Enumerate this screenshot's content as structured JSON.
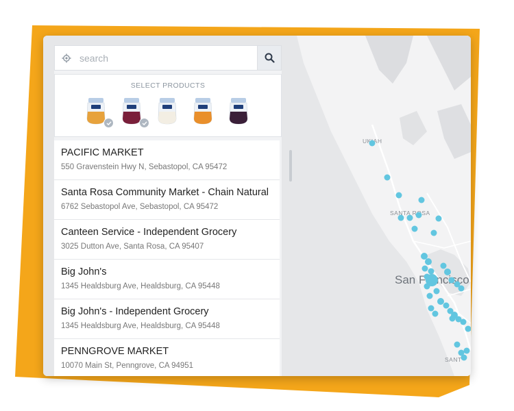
{
  "search": {
    "placeholder": "search"
  },
  "products": {
    "title": "SELECT PRODUCTS",
    "items": [
      {
        "name": "product-1",
        "lid": "#b8cde6",
        "fill": "#e7a23c",
        "checked": true
      },
      {
        "name": "product-2",
        "lid": "#b8cde6",
        "fill": "#7a1f3a",
        "checked": true
      },
      {
        "name": "product-3",
        "lid": "#b8cde6",
        "fill": "#f3eee3",
        "checked": false
      },
      {
        "name": "product-4",
        "lid": "#b8cde6",
        "fill": "#e98f2b",
        "checked": false
      },
      {
        "name": "product-5",
        "lid": "#b8cde6",
        "fill": "#3a1f38",
        "checked": false
      }
    ]
  },
  "stores": [
    {
      "name": "PACIFIC MARKET",
      "address": "550 Gravenstein Hwy N, Sebastopol, CA 95472"
    },
    {
      "name": "Santa Rosa Community Market - Chain Natural",
      "address": "6762 Sebastopol Ave, Sebastopol, CA 95472"
    },
    {
      "name": "Canteen Service - Independent Grocery",
      "address": "3025 Dutton Ave, Santa Rosa, CA 95407"
    },
    {
      "name": "Big John's",
      "address": "1345 Healdsburg Ave, Healdsburg, CA 95448"
    },
    {
      "name": "Big John's - Independent Grocery",
      "address": "1345 Healdsburg Ave, Healdsburg, CA 95448"
    },
    {
      "name": "PENNGROVE MARKET",
      "address": "10070 Main St, Penngrove, CA 94951"
    }
  ],
  "map": {
    "labels": {
      "ukiah": "UKIAH",
      "santa_rosa": "SANTA ROSA",
      "san_francisco": "San Francisco",
      "santa_cruz": "SANT"
    },
    "marker_color": "#62c6e0"
  },
  "colors": {
    "accent_orange": "#f4a61a",
    "marker": "#62c6e0"
  }
}
